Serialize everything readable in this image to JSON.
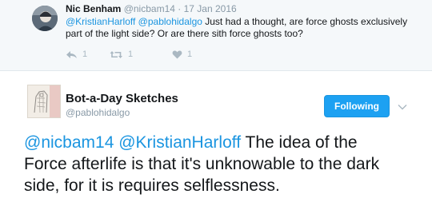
{
  "reply": {
    "name": "Nic Benham",
    "handle": "@nicbam14",
    "separator": "·",
    "date": "17 Jan 2016",
    "mention_1": "@KristianHarloff",
    "mention_2": "@pablohidalgo",
    "text": " Just had a thought, are force ghosts exclusively part of the light side? Or are there sith force ghosts too?",
    "actions": {
      "reply_count": "1",
      "retweet_count": "1",
      "like_count": "1"
    }
  },
  "tweet": {
    "name": "Bot-a-Day Sketches",
    "handle": "@pablohidalgo",
    "follow_label": "Following",
    "mention_1": "@nicbam14",
    "mention_2": "@KristianHarloff",
    "text": " The idea of the Force afterlife is that it's unknowable to the dark side, for it is requires selflessness."
  },
  "colors": {
    "accent": "#1da1f2",
    "link": "#1b95e0",
    "muted": "#8899a6",
    "reply_background": "#f5f8fa"
  },
  "icons": {
    "reply": "reply-icon",
    "retweet": "retweet-icon",
    "like": "heart-icon",
    "more": "chevron-down-icon"
  }
}
